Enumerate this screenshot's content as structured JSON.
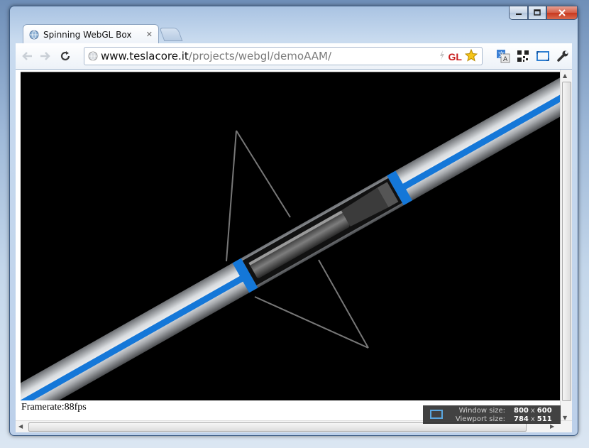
{
  "browser": {
    "tab": {
      "title": "Spinning WebGL Box",
      "close": "✕"
    },
    "address": {
      "domain": "www.teslacore.it",
      "path": "/projects/webgl/demoAAM/"
    },
    "badge": "GL"
  },
  "page": {
    "framerate": "Framerate:88fps"
  },
  "size_overlay": {
    "window_label": "Window size:",
    "window_w": "800",
    "window_h": "600",
    "viewport_label": "Viewport size:",
    "viewport_w": "784",
    "viewport_h": "511",
    "times": "x"
  },
  "colors": {
    "accent_blue": "#1477d8",
    "tube_silver": "#c9ccd0",
    "canvas_bg": "#000000"
  },
  "icons": [
    "globe-icon",
    "back-icon",
    "forward-icon",
    "reload-icon",
    "lightning-icon",
    "star-icon",
    "translate-icon",
    "qr-icon",
    "window-resize-icon",
    "wrench-icon"
  ]
}
